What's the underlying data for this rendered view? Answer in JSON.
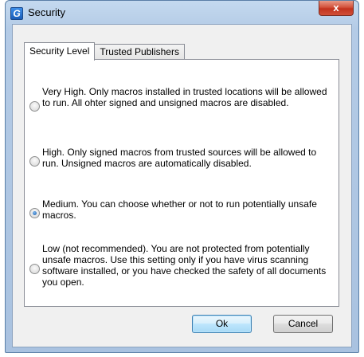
{
  "window": {
    "title": "Security",
    "app_icon_letter": "G",
    "close_glyph": "x"
  },
  "tabs": [
    {
      "label": "Security Level",
      "active": true
    },
    {
      "label": "Trusted Publishers",
      "active": false
    }
  ],
  "security_levels": [
    {
      "text": "Very High. Only macros installed in trusted locations will be allowed to run. All ohter signed and unsigned macros are disabled.",
      "selected": false
    },
    {
      "text": "High. Only signed macros from trusted sources will be allowed to run. Unsigned macros are automatically disabled.",
      "selected": false
    },
    {
      "text": "Medium. You can choose whether or not to run potentially unsafe macros.",
      "selected": true
    },
    {
      "text": "Low (not recommended). You are not protected from potentially unsafe macros. Use this setting only if you have virus scanning software installed, or you have checked the safety of all documents you open.",
      "selected": false
    }
  ],
  "buttons": {
    "ok": "Ok",
    "cancel": "Cancel"
  }
}
